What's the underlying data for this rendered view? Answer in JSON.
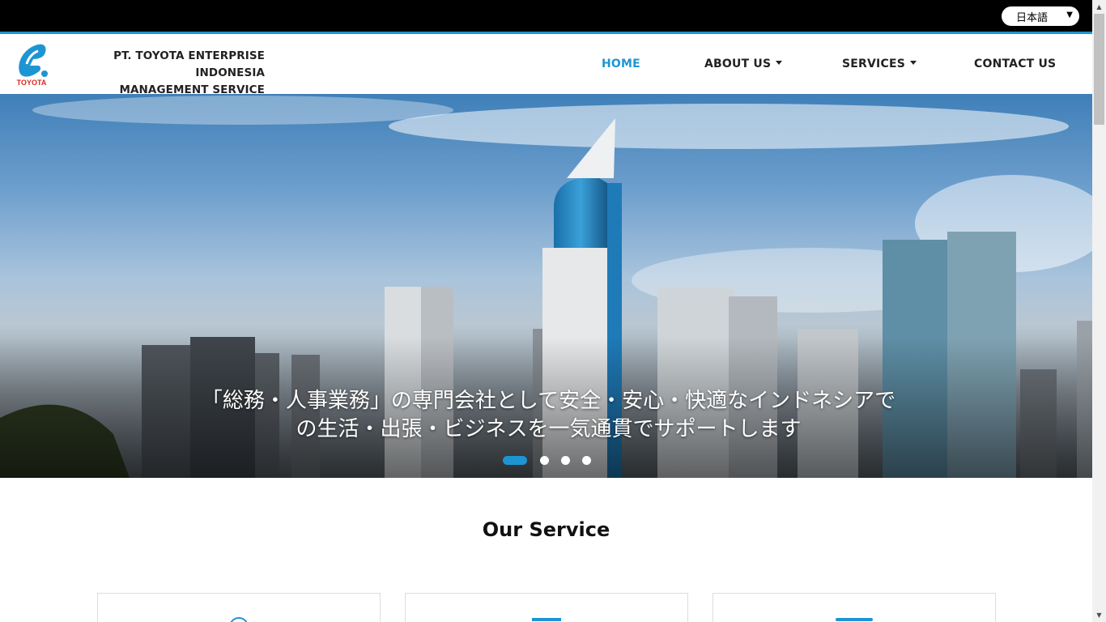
{
  "topbar": {
    "language_selected": "日本語"
  },
  "brand": {
    "logo_text": "TOYOTA",
    "company_line1": "PT. TOYOTA ENTERPRISE INDONESIA",
    "company_line2": "MANAGEMENT SERVICE"
  },
  "nav": {
    "home": "HOME",
    "about": "ABOUT US",
    "services": "SERVICES",
    "contact": "CONTACT US"
  },
  "hero": {
    "caption_line1": "「総務・人事業務」の専門会社として安全・安心・快適なインドネシアで",
    "caption_line2": "の生活・出張・ビジネスを一気通貫でサポートします",
    "slide_count": 4,
    "active_slide": 1
  },
  "services": {
    "title": "Our Service"
  },
  "colors": {
    "accent": "#1e95d3",
    "topbar": "#000000",
    "text": "#222222"
  },
  "icons": {
    "dropdown": "caret-down-icon",
    "scroll_up": "triangle-up-icon",
    "scroll_down": "triangle-down-icon"
  }
}
